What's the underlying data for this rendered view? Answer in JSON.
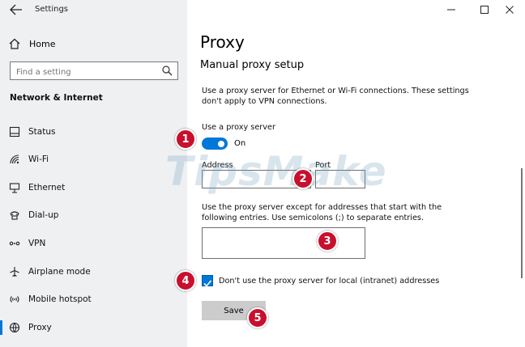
{
  "window": {
    "app_title": "Settings",
    "controls": [
      "minimize-icon",
      "maximize-icon",
      "close-icon"
    ]
  },
  "sidebar": {
    "home_label": "Home",
    "search_placeholder": "Find a setting",
    "section_title": "Network & Internet",
    "items": [
      {
        "label": "Status",
        "icon": "status-icon"
      },
      {
        "label": "Wi-Fi",
        "icon": "wifi-icon"
      },
      {
        "label": "Ethernet",
        "icon": "ethernet-icon"
      },
      {
        "label": "Dial-up",
        "icon": "dialup-icon"
      },
      {
        "label": "VPN",
        "icon": "vpn-icon"
      },
      {
        "label": "Airplane mode",
        "icon": "airplane-icon"
      },
      {
        "label": "Mobile hotspot",
        "icon": "hotspot-icon"
      },
      {
        "label": "Proxy",
        "icon": "proxy-icon",
        "selected": true
      }
    ]
  },
  "main": {
    "page_title": "Proxy",
    "section_title": "Manual proxy setup",
    "description": "Use a proxy server for Ethernet or Wi-Fi connections. These settings don't apply to VPN connections.",
    "use_proxy_label": "Use a proxy server",
    "toggle_state": "On",
    "address_label": "Address",
    "address_value": "",
    "port_label": "Port",
    "port_value": "",
    "exceptions_description": "Use the proxy server except for addresses that start with the following entries. Use semicolons (;) to separate entries.",
    "exceptions_value": "",
    "bypass_local_label": "Don't use the proxy server for local (intranet) addresses",
    "bypass_local_checked": true,
    "save_label": "Save"
  },
  "annotations": {
    "badges": [
      "1",
      "2",
      "3",
      "4",
      "5"
    ],
    "watermark": "TipsMake",
    "badge_color": "#c8102e"
  },
  "colors": {
    "accent": "#0078d7",
    "sidebar_bg": "#eef0f2",
    "button_bg": "#cccccc"
  }
}
